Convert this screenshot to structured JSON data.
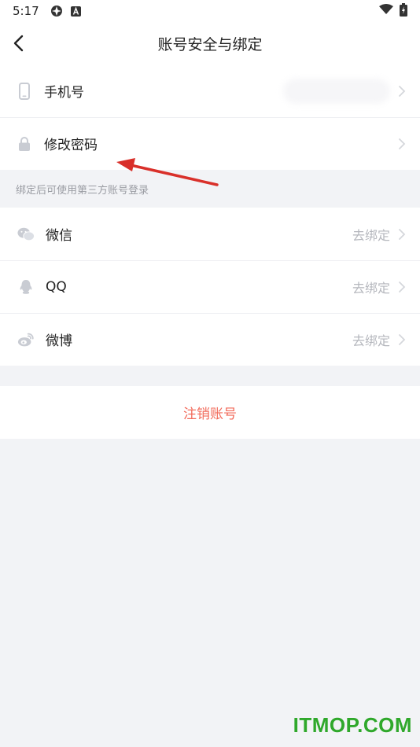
{
  "status_bar": {
    "time": "5:17"
  },
  "nav": {
    "title": "账号安全与绑定"
  },
  "account_rows": [
    {
      "label": "手机号",
      "icon": "phone-icon"
    },
    {
      "label": "修改密码",
      "icon": "lock-icon"
    }
  ],
  "section_tip": "绑定后可使用第三方账号登录",
  "social_rows": [
    {
      "label": "微信",
      "action": "去绑定",
      "icon": "wechat-icon"
    },
    {
      "label": "QQ",
      "action": "去绑定",
      "icon": "qq-icon"
    },
    {
      "label": "微博",
      "action": "去绑定",
      "icon": "weibo-icon"
    }
  ],
  "cancel_account": "注销账号",
  "watermark": "ITMOP.COM",
  "colors": {
    "accent_red": "#f26b5b",
    "watermark_green": "#2fa82b",
    "arrow_red": "#d9302a",
    "icon_gray": "#c9ccd3",
    "background": "#f2f3f6"
  }
}
